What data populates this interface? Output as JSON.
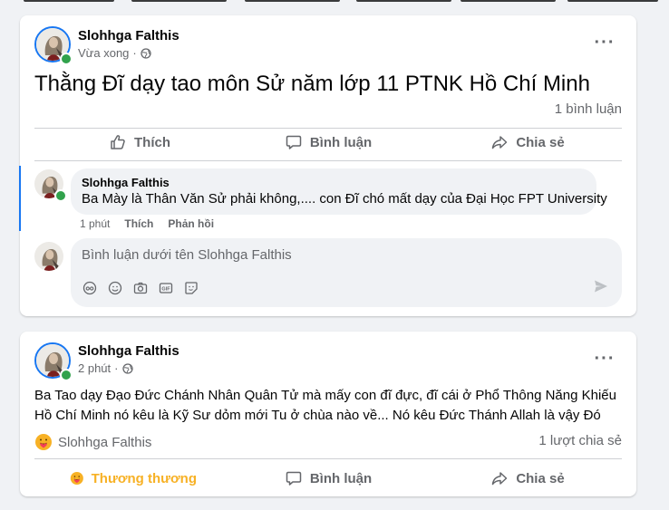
{
  "post1": {
    "author": "Slohhga Falthis",
    "time": "Vừa xong",
    "text": "Thằng Đĩ dạy tao môn Sử năm lớp 11 PTNK Hồ Chí Minh",
    "comment_count": "1 bình luận",
    "actions": {
      "like": "Thích",
      "comment": "Bình luận",
      "share": "Chia sẻ"
    },
    "comment": {
      "author": "Slohhga Falthis",
      "text": "Ba Mày là Thân Văn Sử phải không,.... con Đĩ chó mất dạy của Đại Học FPT University",
      "time": "1 phút",
      "like": "Thích",
      "reply": "Phản hồi"
    },
    "composer_placeholder": "Bình luận dưới tên Slohhga Falthis"
  },
  "post2": {
    "author": "Slohhga Falthis",
    "time": "2 phút",
    "text": "Ba Tao dạy Đạo Đức Chánh Nhân Quân Tử mà mấy con đĩ đực, đĩ cái ở Phổ Thông Năng Khiếu Hồ Chí Minh nó kêu là Kỹ Sư dỏm mới Tu ở chùa nào về... Nó kêu Đức Thánh Allah là vậy Đó",
    "reactor": "Slohhga Falthis",
    "share_count": "1 lượt chia sẻ",
    "actions": {
      "react": "Thương thương",
      "comment": "Bình luận",
      "share": "Chia sẻ"
    }
  },
  "icons": {
    "more": "more-options-icon",
    "globe": "globe-icon",
    "like": "thumbs-up-icon",
    "comment": "comment-icon",
    "share": "share-icon",
    "care": "care-reaction-icon",
    "send": "send-icon"
  },
  "colors": {
    "accent": "#1877f2",
    "online": "#31a24c",
    "care": "#f7b125",
    "muted": "#65676b"
  }
}
